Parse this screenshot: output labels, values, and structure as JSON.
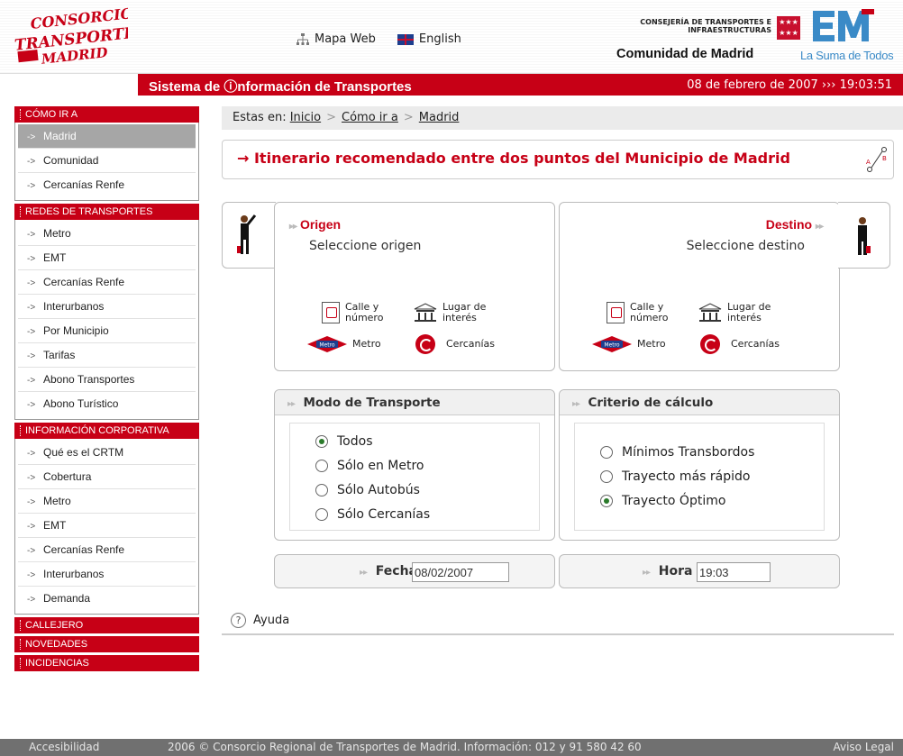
{
  "header": {
    "logo_text": "CONSORCIO TRANSPORTES MADRID",
    "sitemap_label": "Mapa Web",
    "english_label": "English",
    "consejeria": "CONSEJERÍA DE TRANSPORTES E INFRAESTRUCTURAS",
    "comunidad": "Comunidad de Madrid",
    "suma": "La Suma de Todos",
    "system_title": "Sistema de ⓘnformación de Transportes",
    "datetime": "08 de febrero de 2007  ›››  19:03:51"
  },
  "sidebar": {
    "sections": [
      {
        "title": "CÓMO IR A",
        "items": [
          "Madrid",
          "Comunidad",
          "Cercanías Renfe"
        ]
      },
      {
        "title": "REDES DE TRANSPORTES",
        "items": [
          "Metro",
          "EMT",
          "Cercanías Renfe",
          "Interurbanos",
          "Por Municipio",
          "Tarifas",
          "Abono Transportes",
          "Abono Turístico"
        ]
      },
      {
        "title": "INFORMACIÓN CORPORATIVA",
        "items": [
          "Qué es el CRTM",
          "Cobertura",
          "Metro",
          "EMT",
          "Cercanías Renfe",
          "Interurbanos",
          "Demanda"
        ]
      }
    ],
    "solo": [
      "CALLEJERO",
      "NOVEDADES",
      "INCIDENCIAS"
    ],
    "arrow": "->"
  },
  "breadcrumb": {
    "prefix": "Estas en:",
    "items": [
      "Inicio",
      "Cómo ir a",
      "Madrid"
    ],
    "sep": ">"
  },
  "main_title": "→ Itinerario recomendado entre dos puntos del Municipio de Madrid",
  "origen": {
    "title": "Origen",
    "sub": "Seleccione origen"
  },
  "destino": {
    "title": "Destino",
    "sub": "Seleccione destino"
  },
  "options": {
    "calle1": "Calle y",
    "calle2": "número",
    "lugar1": "Lugar de",
    "lugar2": "interés",
    "metro": "Metro",
    "cercanias": "Cercanías",
    "metro_badge": "Metro"
  },
  "modo": {
    "title": "Modo de Transporte",
    "options": [
      "Todos",
      "Sólo en Metro",
      "Sólo Autobús",
      "Sólo Cercanías"
    ],
    "selected": 0
  },
  "criterio": {
    "title": "Criterio de cálculo",
    "options": [
      "Mínimos Transbordos",
      "Trayecto más rápido",
      "Trayecto Óptimo"
    ],
    "selected": 2
  },
  "fecha": {
    "label": "Fecha",
    "value": "08/02/2007"
  },
  "hora": {
    "label": "Hora",
    "value": "19:03"
  },
  "ayuda": "Ayuda",
  "dots": "▸▸",
  "footer": {
    "accesibilidad": "Accesibilidad",
    "copy": "2006 © Consorcio Regional de Transportes de Madrid. Información: 012 y 91 580 42 60",
    "aviso": "Aviso Legal"
  },
  "colors": {
    "brand_red": "#c70016",
    "footer_gray": "#707070",
    "suma_blue": "#3a8ac7"
  }
}
